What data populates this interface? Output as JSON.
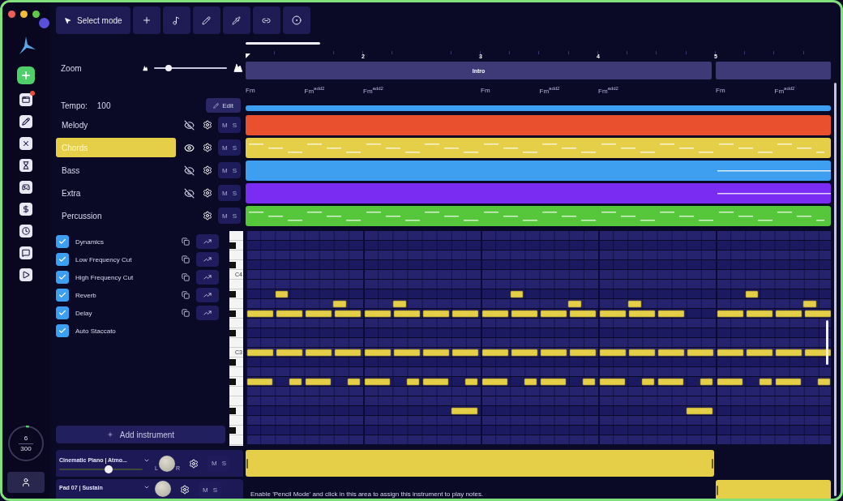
{
  "toolbar": {
    "mode_button": "Select mode"
  },
  "zoom": {
    "label": "Zoom",
    "level": 0.2
  },
  "tempo": {
    "label": "Tempo:",
    "value": "100",
    "edit_button": "Edit"
  },
  "tracks": [
    {
      "name": "Melody",
      "selected": false,
      "has_visibility": true,
      "color": "#e8502e",
      "kind": "empty",
      "mute": "M",
      "solo": "S"
    },
    {
      "name": "Chords",
      "selected": true,
      "has_visibility": true,
      "color": "#e6cf48",
      "kind": "full",
      "mute": "M",
      "solo": "S"
    },
    {
      "name": "Bass",
      "selected": false,
      "has_visibility": true,
      "color": "#3e9ff0",
      "kind": "tail",
      "mute": "M",
      "solo": "S"
    },
    {
      "name": "Extra",
      "selected": false,
      "has_visibility": true,
      "color": "#7b2cf2",
      "kind": "tail",
      "mute": "M",
      "solo": "S"
    },
    {
      "name": "Percussion",
      "selected": false,
      "has_visibility": false,
      "color": "#56c63a",
      "kind": "full",
      "mute": "M",
      "solo": "S"
    }
  ],
  "effects": [
    {
      "name": "Dynamics",
      "checked": true,
      "automatable": true
    },
    {
      "name": "Low Frequency Cut",
      "checked": true,
      "automatable": true
    },
    {
      "name": "High Frequency Cut",
      "checked": true,
      "automatable": true
    },
    {
      "name": "Reverb",
      "checked": true,
      "automatable": true
    },
    {
      "name": "Delay",
      "checked": true,
      "automatable": true
    },
    {
      "name": "Auto Staccato",
      "checked": true,
      "automatable": false
    }
  ],
  "keyboard": {
    "labels": [
      "C4",
      "C3"
    ]
  },
  "add_instrument": "Add instrument",
  "counter": {
    "value": "6",
    "total": "300",
    "level": 0.03
  },
  "instruments": [
    {
      "name": "Cinematic Piano | Atmo...",
      "level": 0.59,
      "pan_left": "L",
      "pan_right": "R",
      "mute": "M",
      "solo": "S"
    },
    {
      "name": "Pad 07 | Sustain",
      "mute": "M",
      "solo": "S"
    }
  ],
  "timeline": {
    "bar_numbers": [
      "2",
      "3",
      "4",
      "5"
    ],
    "sections": [
      {
        "kind": "named",
        "label": "Intro"
      },
      {
        "kind": "blank"
      }
    ],
    "chords": [
      {
        "kind": "chord",
        "label": "Fm"
      },
      {
        "kind": "chord",
        "label": "Fm$^{add2}$"
      },
      {
        "kind": "chord",
        "label": "Fm$^{add2}$"
      },
      {
        "kind": "rest"
      },
      {
        "kind": "chord",
        "label": "Fm"
      },
      {
        "kind": "chord",
        "label": "Fm$^{add2}$"
      },
      {
        "kind": "chord",
        "label": "Fm$^{add2}$"
      },
      {
        "kind": "rest"
      },
      {
        "kind": "chord",
        "label": "Fm"
      },
      {
        "kind": "chord",
        "label": "Fm$^{add2}$"
      }
    ]
  },
  "hint": "Enable 'Pencil Mode' and click in this area to assign this instrument to play notes."
}
